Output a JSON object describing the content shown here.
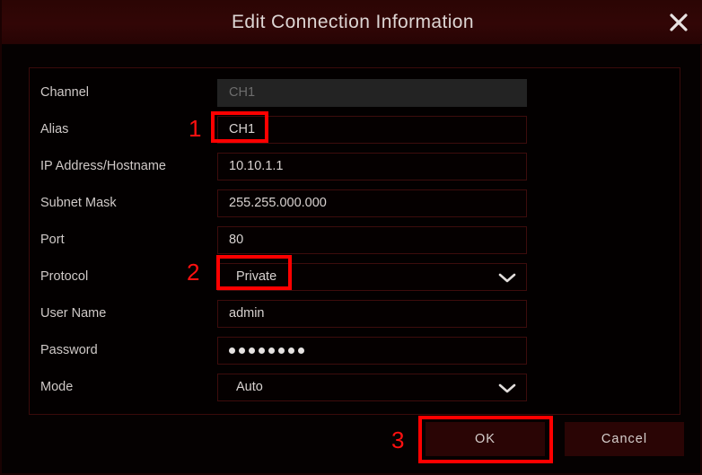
{
  "window": {
    "title": "Edit Connection Information",
    "close_icon": "close-icon"
  },
  "form": {
    "rows": [
      {
        "label": "Channel",
        "value": "CH1",
        "type": "text",
        "disabled": true,
        "indent": false
      },
      {
        "label": "Alias",
        "value": "CH1",
        "type": "text",
        "disabled": false,
        "indent": false
      },
      {
        "label": "IP Address/Hostname",
        "value": "10.10.1.1",
        "type": "text",
        "disabled": false,
        "indent": false
      },
      {
        "label": "Subnet Mask",
        "value": "255.255.000.000",
        "type": "text",
        "disabled": false,
        "indent": false
      },
      {
        "label": "Port",
        "value": "80",
        "type": "text",
        "disabled": false,
        "indent": false
      },
      {
        "label": "Protocol",
        "value": "Private",
        "type": "dropdown",
        "disabled": false,
        "indent": true
      },
      {
        "label": "User Name",
        "value": "admin",
        "type": "text",
        "disabled": false,
        "indent": false
      },
      {
        "label": "Password",
        "value": "••••••••",
        "masked_count": 8,
        "type": "password",
        "disabled": false,
        "indent": false
      },
      {
        "label": "Mode",
        "value": "Auto",
        "type": "dropdown",
        "disabled": false,
        "indent": true
      }
    ]
  },
  "footer": {
    "ok_label": "OK",
    "cancel_label": "Cancel"
  },
  "annotations": {
    "markers": [
      {
        "number": "1",
        "target": "alias-field"
      },
      {
        "number": "2",
        "target": "protocol-dropdown"
      },
      {
        "number": "3",
        "target": "ok-button"
      }
    ],
    "color": "#ff0000"
  },
  "colors": {
    "titlebar": "#320606",
    "panel_border": "#3a0a0a",
    "field_border": "#3d0c0c",
    "button_bg": "#2a0505",
    "disabled_field_bg": "#232323",
    "text": "#d8d2d0",
    "annotation_red": "#ff0000"
  }
}
